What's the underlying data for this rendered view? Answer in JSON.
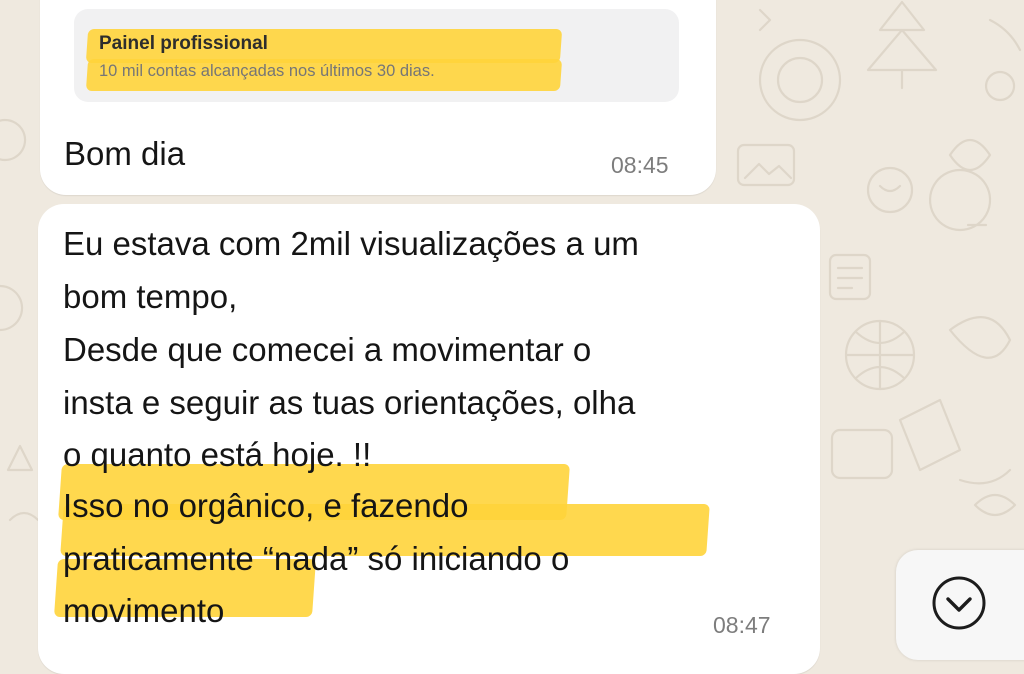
{
  "preview": {
    "title": "Painel profissional",
    "subtitle": "10 mil contas alcançadas nos últimos 30 dias."
  },
  "messages": [
    {
      "lines": [
        "Bom dia"
      ],
      "time": "08:45"
    },
    {
      "lines": [
        "Eu estava com 2mil visualizações a um",
        "bom tempo,",
        "Desde que comecei a movimentar o",
        "insta e seguir as tuas orientações, olha",
        "o quanto está hoje. !!",
        "Isso no orgânico, e fazendo",
        "praticamente “nada” só iniciando o",
        "movimento"
      ],
      "time": "08:47"
    }
  ],
  "scroll_button": {
    "icon": "chevron-down-icon"
  },
  "colors": {
    "highlight": "#ffd43b",
    "bubble": "#ffffff",
    "wallpaper": "#efe9df"
  }
}
